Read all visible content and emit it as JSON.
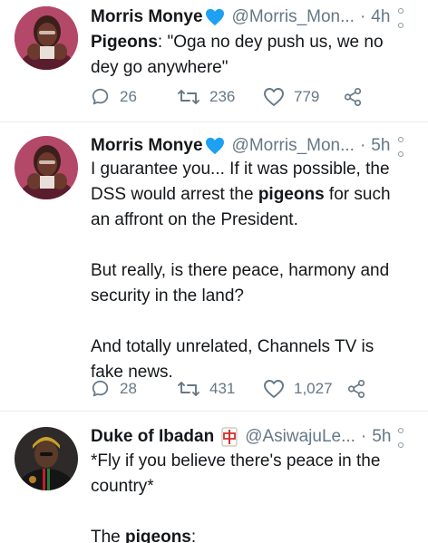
{
  "tweets": [
    {
      "name": "Morris Monye",
      "handle": "@Morris_Mon...",
      "separator": "·",
      "time": "4h",
      "body_label": "Pigeons",
      "body_rest": ": \"Oga no dey push us, we no dey go anywhere\"",
      "replies": "26",
      "retweets": "236",
      "likes": "779"
    },
    {
      "name": "Morris Monye",
      "handle": "@Morris_Mon...",
      "separator": "·",
      "time": "5h",
      "p1_before": "I guarantee you... If it was possible, the DSS would arrest the ",
      "p1_bold": "pigeons",
      "p1_after": " for such an affront on the President.",
      "p2": "But really, is there peace, harmony and security in the land?",
      "p3": "And totally unrelated, Channels TV is fake news.",
      "replies": "28",
      "retweets": "431",
      "likes": "1,027"
    },
    {
      "name": "Duke of Ibadan",
      "handle": "@AsiwajuLe...",
      "separator": "·",
      "time": "5h",
      "p1": "*Fly if you believe there's peace in the country*",
      "p2_before": "The ",
      "p2_bold": "pigeons",
      "p2_after": ":"
    }
  ],
  "colors": {
    "verified": "#1da1f2",
    "mahjong_badge": "#d0312d",
    "secondary_text": "#657786",
    "divider": "#e6ecf0"
  },
  "icons": [
    "reply-icon",
    "retweet-icon",
    "like-icon",
    "share-icon",
    "blue-heart-icon",
    "mahjong-tile-icon",
    "more-options-icon"
  ]
}
